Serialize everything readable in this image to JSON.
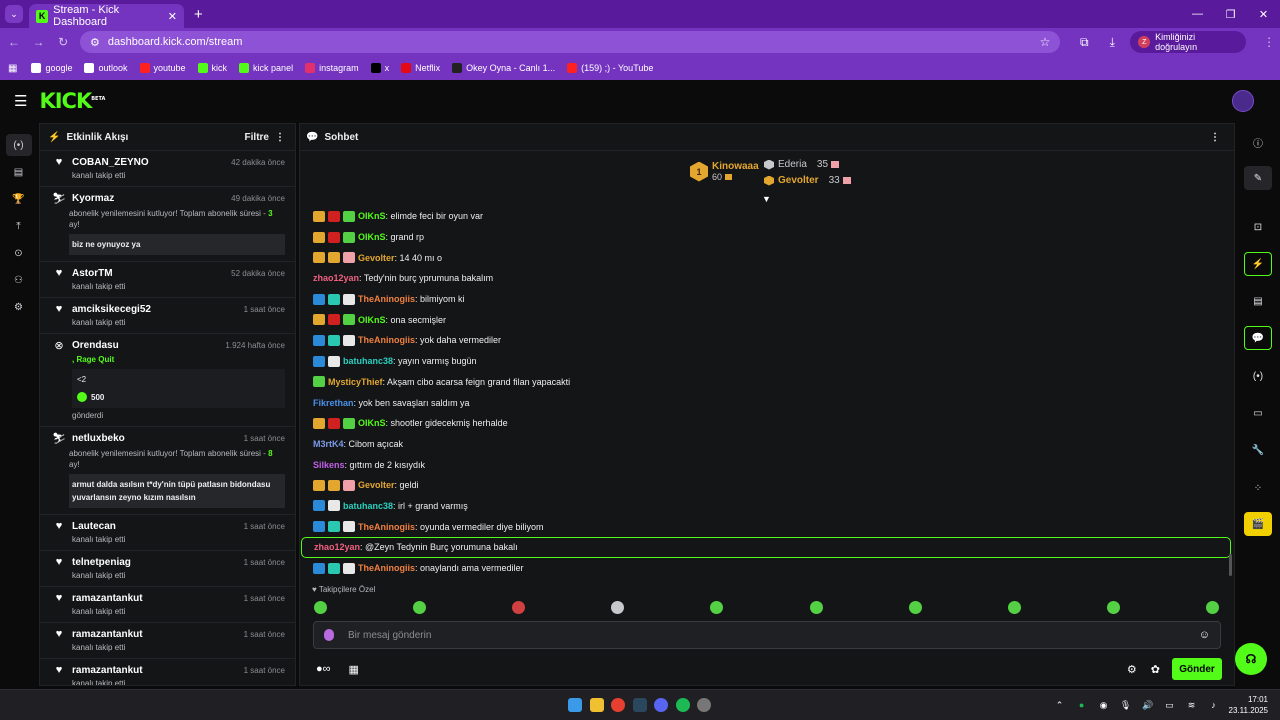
{
  "browser": {
    "tab_title": "Stream - Kick Dashboard",
    "tab_favicon": "K",
    "address": "dashboard.kick.com/stream",
    "verify_label": "Kimliğinizi doğrulayın",
    "verify_initial": "Z",
    "bookmarks": [
      {
        "label": "google",
        "color": "#ffffff"
      },
      {
        "label": "outlook",
        "color": "#ffffff"
      },
      {
        "label": "youtube",
        "color": "#ff2020"
      },
      {
        "label": "kick",
        "color": "#53fc18"
      },
      {
        "label": "kick panel",
        "color": "#53fc18"
      },
      {
        "label": "instagram",
        "color": "#e1306c"
      },
      {
        "label": "x",
        "color": "#000000"
      },
      {
        "label": "Netflix",
        "color": "#e50914"
      },
      {
        "label": "Okey Oyna - Canlı 1...",
        "color": "#222222"
      },
      {
        "label": "(159) ;) - YouTube",
        "color": "#ff2020"
      }
    ]
  },
  "kick": {
    "logo": "KICK",
    "logo_beta": "BETA"
  },
  "activity": {
    "title": "Etkinlik Akışı",
    "filter": "Filtre",
    "events": [
      {
        "icon": "heart",
        "name": "COBAN_ZEYNO",
        "time": "42 dakika önce",
        "sub": "kanalı takip etti"
      },
      {
        "icon": "resub",
        "name": "Kyormaz",
        "time": "49 dakika önce",
        "desc_pre": "abonelik yenilemesini kutluyor! Toplam abonelik süresi - ",
        "desc_num": "3",
        "desc_post": " ay!",
        "message": "biz ne oynuyoz ya"
      },
      {
        "icon": "heart",
        "name": "AstorTM",
        "time": "52 dakika önce",
        "sub": "kanalı takip etti"
      },
      {
        "icon": "heart",
        "name": "amciksikecegi52",
        "time": "1 saat önce",
        "sub": "kanalı takip etti"
      },
      {
        "icon": "gift",
        "name": "Orendasu",
        "time": "1.924 hafta önce",
        "gift_name": ", Rage Quit",
        "gift_msg": "<2",
        "gift_amount": "500",
        "gift_sub": "gönderdi"
      },
      {
        "icon": "resub",
        "name": "netluxbeko",
        "time": "1 saat önce",
        "desc_pre": "abonelik yenilemesini kutluyor! Toplam abonelik süresi - ",
        "desc_num": "8",
        "desc_post": " ay!",
        "message": "armut dalda asılsın t*dy'nin tüpü patlasın bidondasu yuvarlansın zeyno kızım nasılsın"
      },
      {
        "icon": "heart",
        "name": "Lautecan",
        "time": "1 saat önce",
        "sub": "kanalı takip etti"
      },
      {
        "icon": "heart",
        "name": "telnetpeniag",
        "time": "1 saat önce",
        "sub": "kanalı takip etti"
      },
      {
        "icon": "heart",
        "name": "ramazantankut",
        "time": "1 saat önce",
        "sub": "kanalı takip etti"
      },
      {
        "icon": "heart",
        "name": "ramazantankut",
        "time": "1 saat önce",
        "sub": "kanalı takip etti"
      },
      {
        "icon": "heart",
        "name": "ramazantankut",
        "time": "1 saat önce",
        "sub": "kanalı takip etti"
      }
    ]
  },
  "chat": {
    "title": "Sohbet",
    "leaderboard": {
      "first": {
        "rank": "1",
        "name": "Kinowaaa",
        "points": "60"
      },
      "second": {
        "name": "Ederia",
        "points": "35",
        "color": "#c8c8cc"
      },
      "third": {
        "name": "Gevolter",
        "points": "33",
        "color": "#e3a730"
      }
    },
    "messages": [
      {
        "user": "OIKnS",
        "color": "#53fc18",
        "text": ": elimde feci bir oyun var",
        "badges": [
          "#e3a730",
          "#d02020",
          "#53d043"
        ]
      },
      {
        "user": "OIKnS",
        "color": "#53fc18",
        "text": ": grand rp",
        "badges": [
          "#e3a730",
          "#d02020",
          "#53d043"
        ]
      },
      {
        "user": "Gevolter",
        "color": "#e3a730",
        "text": ": 14 40 mı o",
        "badges": [
          "#e3a730",
          "#e3a730",
          "#f0a0a8"
        ]
      },
      {
        "user": "zhao12yan",
        "color": "#f06080",
        "text": ": Tedy'nin burç yprumuna bakalım",
        "badges": []
      },
      {
        "user": "TheAninogiis",
        "color": "#f08040",
        "text": ": bilmiyom ki",
        "badges": [
          "#2a8ad8",
          "#2ac8b0",
          "#e8e8e8"
        ]
      },
      {
        "user": "OIKnS",
        "color": "#53fc18",
        "text": ": ona secmişler",
        "badges": [
          "#e3a730",
          "#d02020",
          "#53d043"
        ]
      },
      {
        "user": "TheAninogiis",
        "color": "#f08040",
        "text": ": yok daha vermediler",
        "badges": [
          "#2a8ad8",
          "#2ac8b0",
          "#e8e8e8"
        ]
      },
      {
        "user": "batuhanc38",
        "color": "#2ad0c0",
        "text": ": yayın varmış bugün",
        "badges": [
          "#2a8ad8",
          "#e8e8e8"
        ]
      },
      {
        "user": "MysticyThief",
        "color": "#e3a730",
        "text": ": Akşam cibo acarsa feign grand filan yapacakti",
        "badges": [
          "#53d043"
        ]
      },
      {
        "user": "Fikrethan",
        "color": "#4a90e8",
        "text": ": yok ben savaşları saldım ya",
        "badges": []
      },
      {
        "user": "OIKnS",
        "color": "#53fc18",
        "text": ": shootler gidecekmiş herhalde",
        "badges": [
          "#e3a730",
          "#d02020",
          "#53d043"
        ]
      },
      {
        "user": "M3rtK4",
        "color": "#7a9ae8",
        "text": ": Cibom açıcak",
        "badges": []
      },
      {
        "user": "Silkens",
        "color": "#c060e8",
        "text": ": gıttım de 2 kısıydık",
        "badges": []
      },
      {
        "user": "Gevolter",
        "color": "#e3a730",
        "text": ": geldi",
        "badges": [
          "#e3a730",
          "#e3a730",
          "#f0a0a8"
        ]
      },
      {
        "user": "batuhanc38",
        "color": "#2ad0c0",
        "text": ": irl + grand varmış",
        "badges": [
          "#2a8ad8",
          "#e8e8e8"
        ]
      },
      {
        "user": "TheAninogiis",
        "color": "#f08040",
        "text": ": oyunda vermediler diye biliyom",
        "badges": [
          "#2a8ad8",
          "#2ac8b0",
          "#e8e8e8"
        ]
      },
      {
        "user": "zhao12yan",
        "color": "#f06080",
        "text": ": @Zeyn Tedynin Burç yorumuna bakalı",
        "badges": [],
        "highlight": true
      },
      {
        "user": "TheAninogiis",
        "color": "#f08040",
        "text": ": onaylandı ama vermediler",
        "badges": [
          "#2a8ad8",
          "#2ac8b0",
          "#e8e8e8"
        ]
      }
    ],
    "followers_only_label": "Takipçilere Özel",
    "input_placeholder": "Bir mesaj gönderin",
    "send_label": "Gönder"
  },
  "taskbar": {
    "time": "17:01",
    "date": "23.11.2025"
  }
}
